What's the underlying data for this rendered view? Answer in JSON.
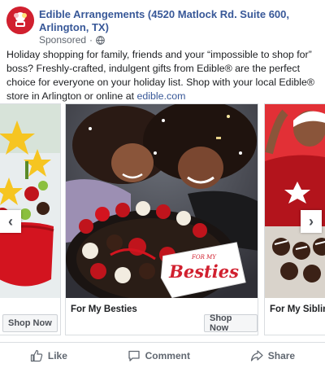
{
  "header": {
    "advertiser": "Edible Arrangements (4520 Matlock Rd. Suite 600, Arlington, TX)",
    "sponsored": "Sponsored",
    "dot": "·"
  },
  "body": {
    "text": "Holiday shopping for family, friends and your “impossible to shop for” boss? Freshly-crafted, indulgent gifts from Edible® are the perfect choice for everyone on your holiday list. Shop with your local Edible® store in Arlington or online at ",
    "link": "edible.com"
  },
  "carousel": {
    "cards": [
      {
        "title": "",
        "cta": "Shop Now"
      },
      {
        "title": "For My Besties",
        "cta": "Shop Now",
        "banner_top": "FOR MY",
        "banner_main": "Besties"
      },
      {
        "title": "For My Siblings",
        "cta": ""
      }
    ],
    "prev_arrow": "‹",
    "next_arrow": "›"
  },
  "actions": {
    "like": "Like",
    "comment": "Comment",
    "share": "Share"
  },
  "colors": {
    "link": "#385898",
    "brand_red": "#d1202f",
    "meta_text": "#606770"
  }
}
